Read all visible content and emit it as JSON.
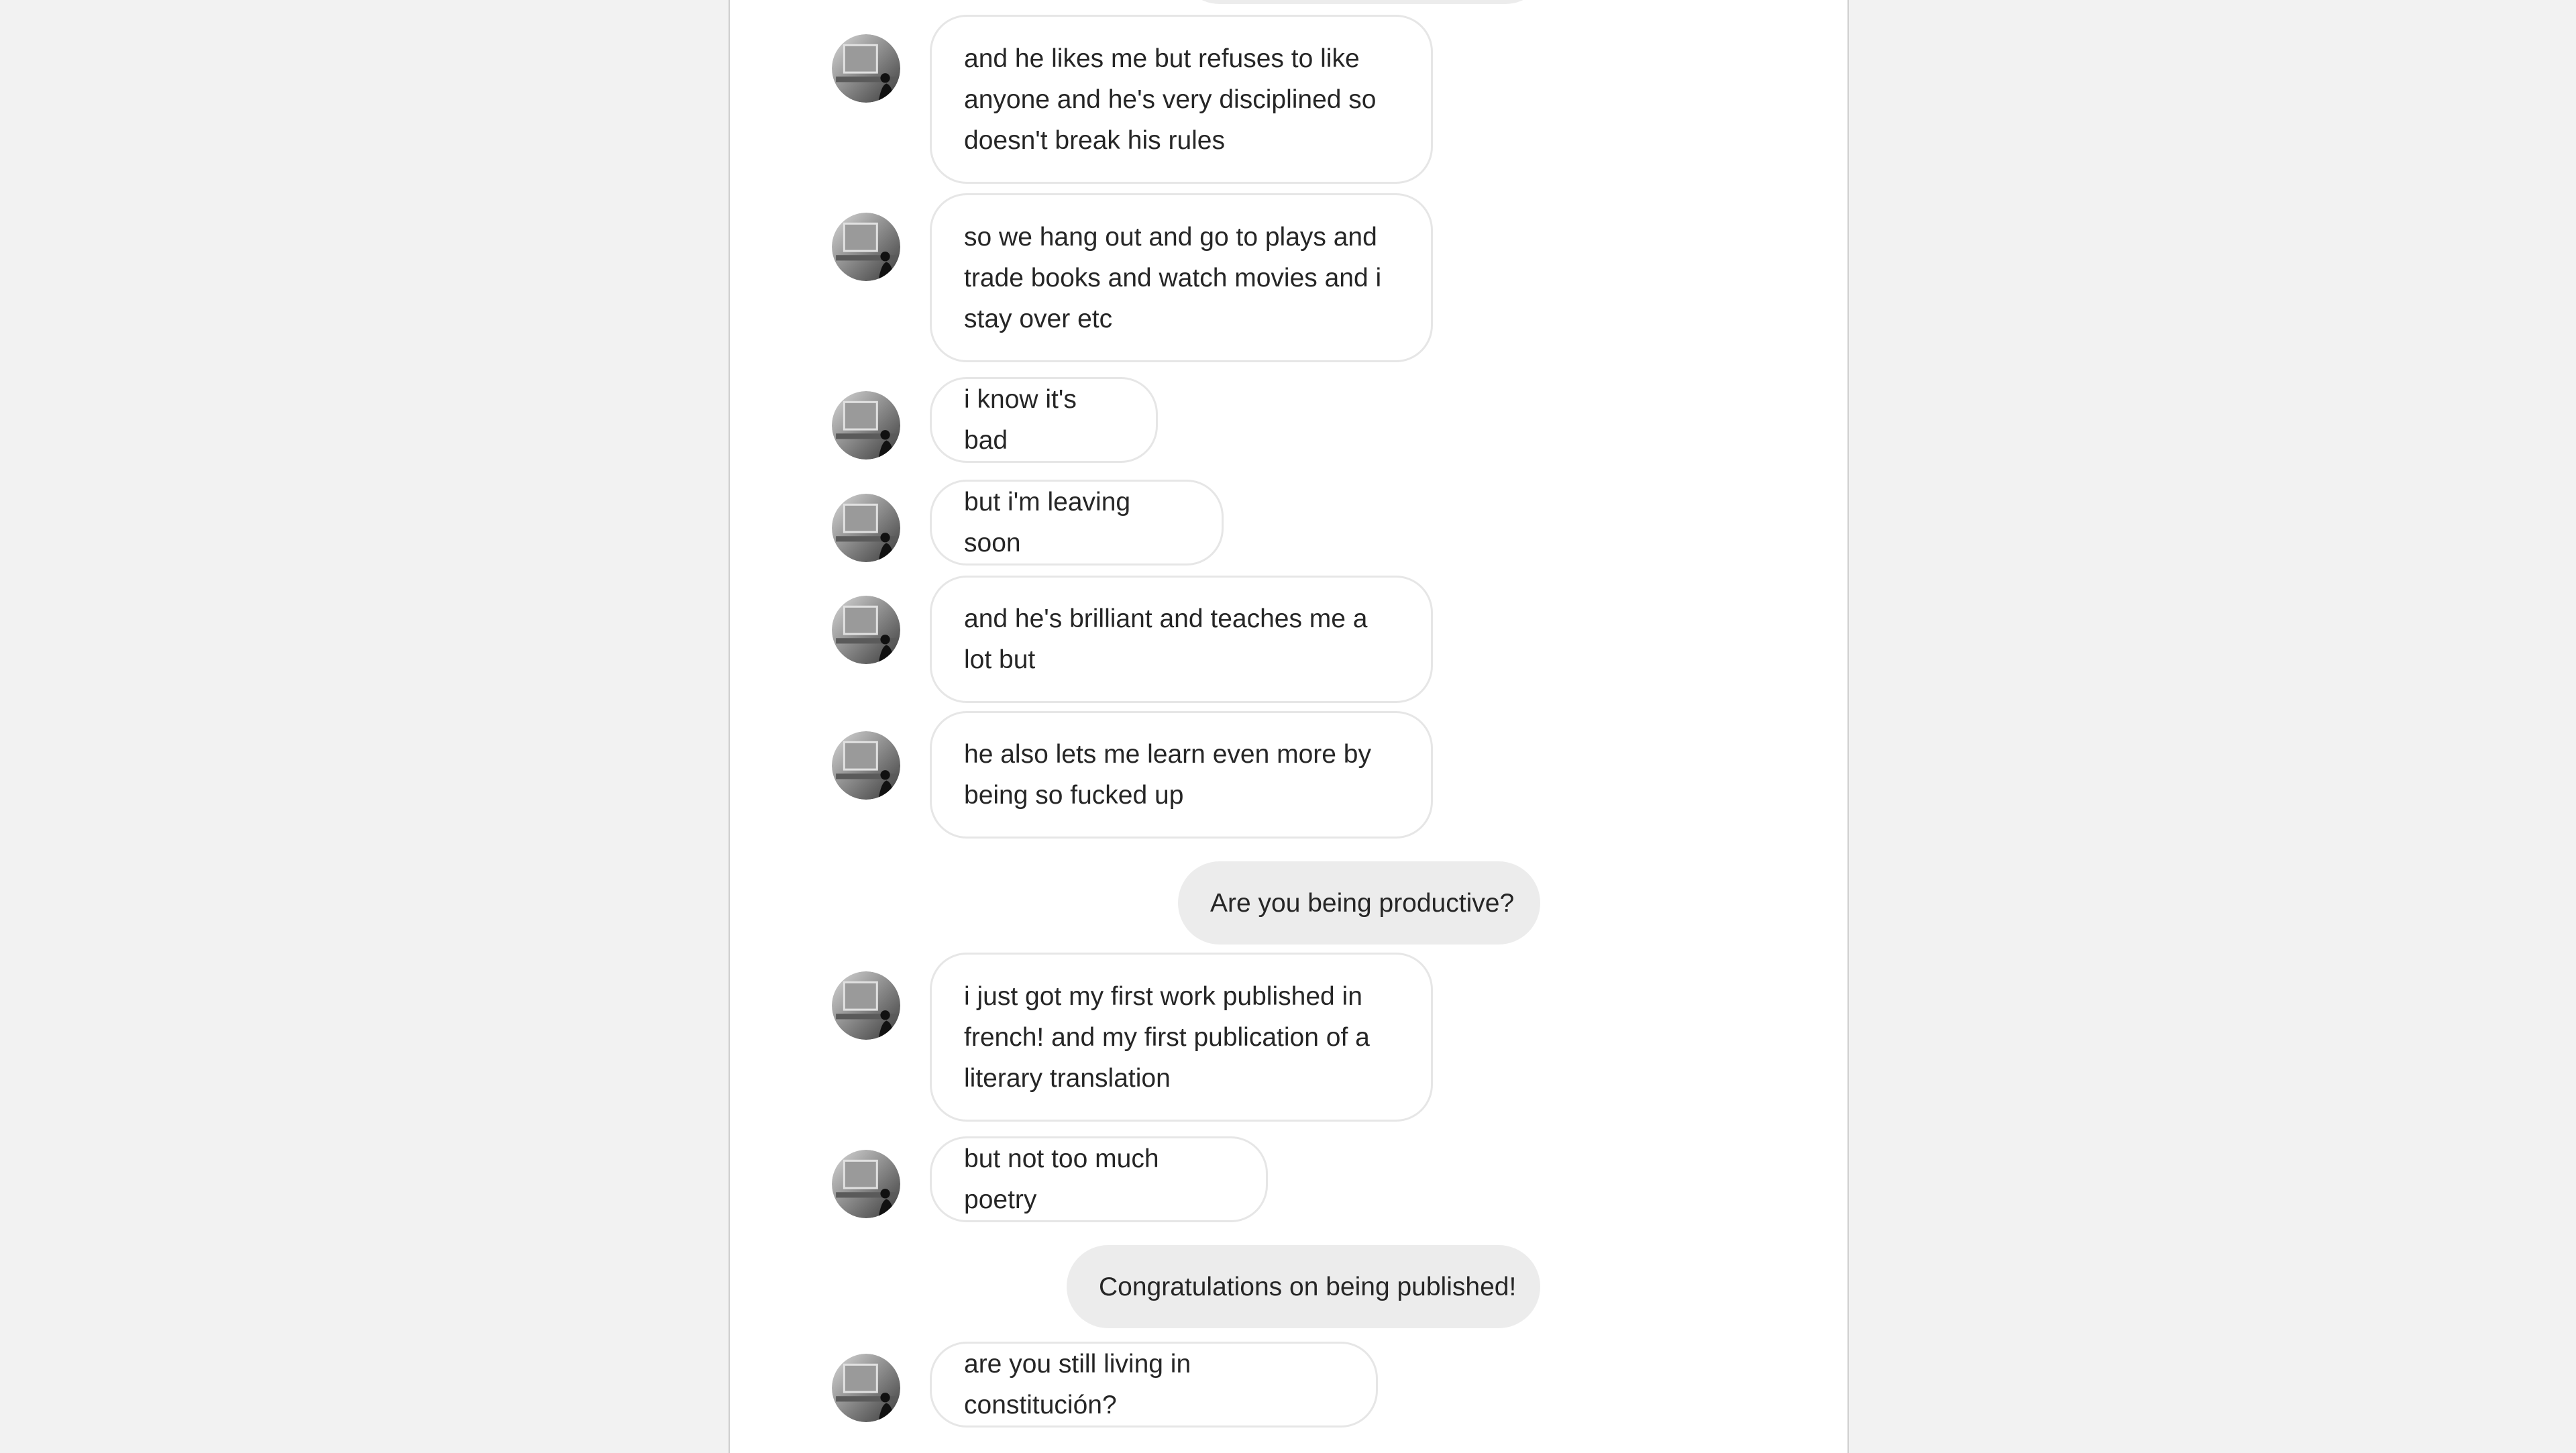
{
  "conversation": {
    "messages": [
      {
        "dir": "in",
        "text": "and he likes me but refuses to like anyone and he's very disciplined so doesn't break his rules"
      },
      {
        "dir": "in",
        "text": "so we hang out and go to plays and trade books and watch movies and i stay over etc"
      },
      {
        "dir": "in",
        "text": "i know it's bad"
      },
      {
        "dir": "in",
        "text": "but i'm leaving soon"
      },
      {
        "dir": "in",
        "text": "and he's brilliant and teaches me a lot but"
      },
      {
        "dir": "in",
        "text": "he also lets me learn even more by being so fucked up"
      },
      {
        "dir": "out",
        "text": "Are you being productive?"
      },
      {
        "dir": "in",
        "text": "i just got my first work published in french! and my first publication of a literary translation"
      },
      {
        "dir": "in",
        "text": "but not too much poetry"
      },
      {
        "dir": "out",
        "text": "Congratulations on being published!"
      },
      {
        "dir": "in",
        "text": "are you still living in constitución?"
      }
    ]
  },
  "colors": {
    "page_background": "#f2f2f2",
    "panel_background": "#ffffff",
    "incoming_bubble_border": "#e6e6e6",
    "outgoing_bubble_background": "#ececec",
    "text": "#262626"
  },
  "icons": {
    "avatar": "avatar-icon"
  }
}
